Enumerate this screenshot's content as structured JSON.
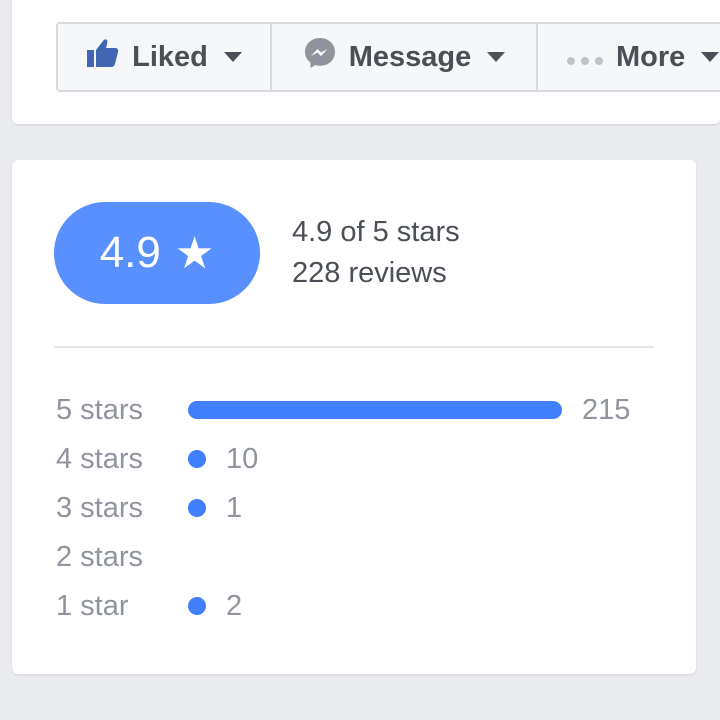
{
  "actions": {
    "liked_label": "Liked",
    "message_label": "Message",
    "more_label": "More"
  },
  "rating": {
    "score": "4.9",
    "star_glyph": "★",
    "summary_line1": "4.9 of 5 stars",
    "summary_line2": "228 reviews"
  },
  "breakdown": [
    {
      "label": "5 stars",
      "count": "215",
      "value": 215
    },
    {
      "label": "4 stars",
      "count": "10",
      "value": 10
    },
    {
      "label": "3 stars",
      "count": "1",
      "value": 1
    },
    {
      "label": "2 stars",
      "count": "",
      "value": 0
    },
    {
      "label": "1 star",
      "count": "2",
      "value": 2
    }
  ],
  "colors": {
    "accent": "#5890ff",
    "bar": "#4080ff",
    "text_dark": "#4b4f56",
    "text_muted": "#90949c"
  },
  "icons": {
    "liked": "thumbs-up-icon",
    "message": "messenger-icon",
    "more": "ellipsis-icon"
  }
}
